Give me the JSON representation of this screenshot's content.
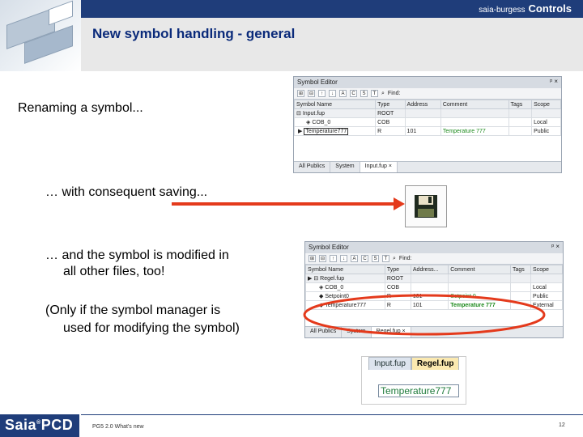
{
  "slide": {
    "title": "New symbol handling - general",
    "brand_prefix": "saia-burgess",
    "brand_name": "Controls",
    "text_renaming": "Renaming a symbol...",
    "text_saving": "… with consequent saving...",
    "text_modified_1": "… and the symbol is modified in",
    "text_modified_2": "all other files, too!",
    "text_note_1": "(Only if the symbol manager is",
    "text_note_2": "used for modifying the symbol)",
    "logo_saia": "Saia",
    "logo_reg": "®",
    "logo_pcd": "PCD",
    "footer_left": "PG5 2.0 What's new",
    "footer_page": "12",
    "colors": {
      "title": "#0a2a7a",
      "brand": "#1f3d7a",
      "arrow": "#e43a1c",
      "highlight": "#e43a1c"
    }
  },
  "editor1": {
    "title": "Symbol Editor",
    "pins": "ᵖ ×",
    "find": "Find:",
    "columns": [
      "Symbol Name",
      "Type",
      "Address",
      "Comment",
      "Tags",
      "Scope"
    ],
    "rows": [
      [
        "Input.fup",
        "ROOT",
        "",
        "",
        "",
        ""
      ],
      [
        "COB_0",
        "COB",
        "",
        "",
        "",
        "Local"
      ],
      [
        "Temperature777",
        "R",
        "101",
        "Temperature 777",
        "",
        "Public"
      ]
    ],
    "tabs": [
      "All Publics",
      "System",
      "Input.fup ×"
    ]
  },
  "editor2": {
    "title": "Symbol Editor",
    "pins": "ᵖ ×",
    "find": "Find:",
    "columns": [
      "Symbol Name",
      "Type",
      "Address...",
      "Comment",
      "Tags",
      "Scope"
    ],
    "rows": [
      [
        "Regel.fup",
        "ROOT",
        "",
        "",
        "",
        ""
      ],
      [
        "COB_0",
        "COB",
        "",
        "",
        "",
        "Local"
      ],
      [
        "Setpoint0",
        "R",
        "101",
        "Setpoint 0",
        "",
        "Public"
      ],
      [
        "Temperature777",
        "R",
        "101",
        "Temperature 777",
        "",
        "External"
      ]
    ],
    "tabs": [
      "All Publics",
      "System",
      "Regel.fup ×"
    ]
  },
  "fup": {
    "tab1": "Input.fup",
    "tab2": "Regel.fup",
    "field_value": "Temperature777"
  },
  "icons": [
    "floppy-disk-icon",
    "pin-icon",
    "close-icon",
    "find-icon",
    "expand-icon",
    "collapse-icon",
    "row-pointer-icon"
  ]
}
